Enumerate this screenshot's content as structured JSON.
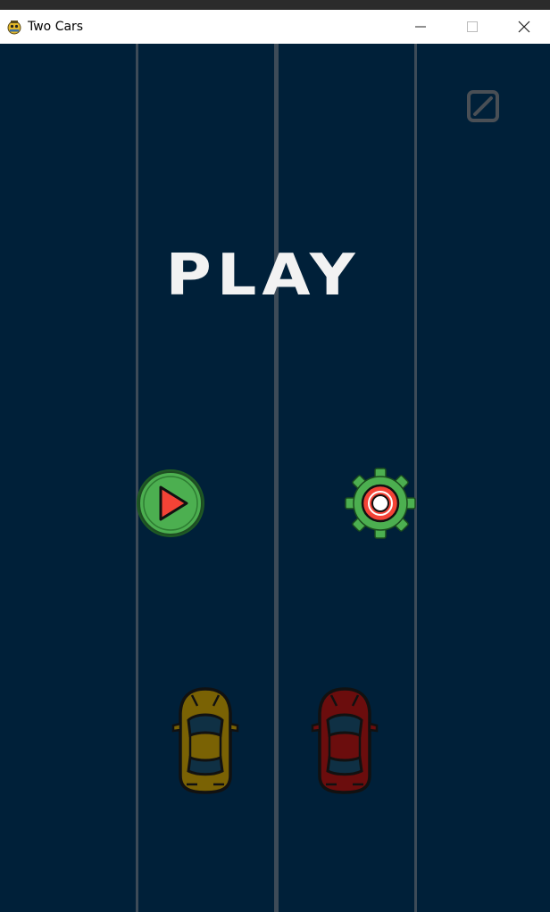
{
  "window": {
    "title": "Two Cars",
    "minimize_glyph": "—",
    "maximize_glyph": "☐",
    "close_glyph": "✕"
  },
  "game": {
    "screen_title": "PLAY",
    "icons": {
      "pause": "pause-toggle-icon",
      "play": "play-icon",
      "settings": "gear-icon",
      "cars": [
        "yellow-car",
        "red-car"
      ]
    },
    "colors": {
      "background": "#002039",
      "lane_line": "#3d4b58",
      "title_text": "#f2f2f2",
      "play_circle": "#4caf50",
      "play_triangle": "#f44336",
      "gear": "#4caf50",
      "gear_center": "#f44336",
      "yellow_car": "#7a6204",
      "red_car": "#6b0d0d"
    }
  }
}
